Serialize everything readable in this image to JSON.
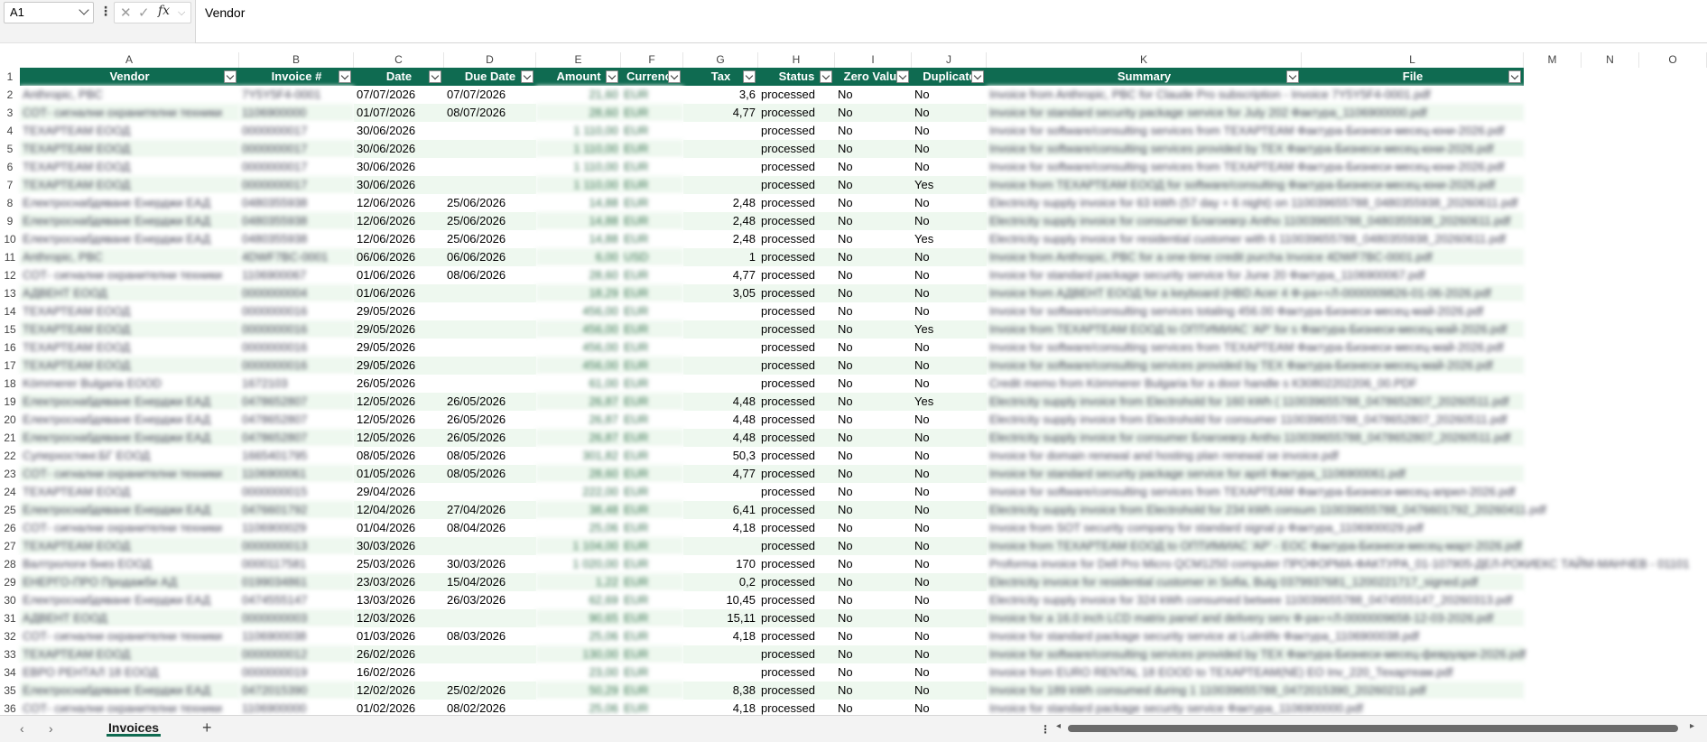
{
  "formula_bar": {
    "name_box": "A1",
    "fx": "fx",
    "content": "Vendor"
  },
  "columns": [
    "A",
    "B",
    "C",
    "D",
    "E",
    "F",
    "G",
    "H",
    "I",
    "J",
    "K",
    "L",
    "M",
    "N",
    "O"
  ],
  "header": [
    "Vendor",
    "Invoice #",
    "Date",
    "Due Date",
    "Amount",
    "Currency",
    "Tax",
    "Status",
    "Zero Value",
    "Duplicate",
    "Summary",
    "File"
  ],
  "rows": [
    {
      "n": "2",
      "vendor": "Anthropic, PBC",
      "inv": "7Y5Y5F4-0001",
      "date": "07/07/2026",
      "due": "07/07/2026",
      "amount": "21,60",
      "cur": "EUR",
      "tax": "3,6",
      "status": "processed",
      "zero": "No",
      "dup": "No",
      "summary": "Invoice from Anthropic, PBC for Claude Pro subscription - Invoice 7Y5Y5F4-0001.pdf"
    },
    {
      "n": "3",
      "vendor": "СОТ- сигнални охранителни техники",
      "inv": "1106900000",
      "date": "01/07/2026",
      "due": "08/07/2026",
      "amount": "28,60",
      "cur": "EUR",
      "tax": "4,77",
      "status": "processed",
      "zero": "No",
      "dup": "No",
      "summary": "Invoice for standard security package service for July 202 Фактура_1106900000.pdf"
    },
    {
      "n": "4",
      "vendor": "ТЕХАРТЕАМ ЕООД",
      "inv": "0000000017",
      "date": "30/06/2026",
      "due": "",
      "amount": "1 110,00",
      "cur": "EUR",
      "tax": "",
      "status": "processed",
      "zero": "No",
      "dup": "No",
      "summary": "Invoice for software/consulting services from ТЕХАРТЕАМ Фактура-Бизнеси-месец-юни-2026.pdf"
    },
    {
      "n": "5",
      "vendor": "ТЕХАРТЕАМ ЕООД",
      "inv": "0000000017",
      "date": "30/06/2026",
      "due": "",
      "amount": "1 110,00",
      "cur": "EUR",
      "tax": "",
      "status": "processed",
      "zero": "No",
      "dup": "No",
      "summary": "Invoice for software/consulting services provided by TEX Фактура-Бизнеси-месец-юни-2026.pdf"
    },
    {
      "n": "6",
      "vendor": "ТЕХАРТЕАМ ЕООД",
      "inv": "0000000017",
      "date": "30/06/2026",
      "due": "",
      "amount": "1 110,00",
      "cur": "EUR",
      "tax": "",
      "status": "processed",
      "zero": "No",
      "dup": "No",
      "summary": "Invoice for software/consulting services from ТЕХАРТЕАМ Фактура-Бизнеси-месец-юни-2026.pdf"
    },
    {
      "n": "7",
      "vendor": "ТЕХАРТЕАМ ЕООД",
      "inv": "0000000017",
      "date": "30/06/2026",
      "due": "",
      "amount": "1 110,00",
      "cur": "EUR",
      "tax": "",
      "status": "processed",
      "zero": "No",
      "dup": "Yes",
      "summary": "Invoice from ТЕХАРТЕАМ ЕООД for software/consulting Фактура-Бизнеси-месец-юни-2026.pdf"
    },
    {
      "n": "8",
      "vendor": "Електроснабдяване Енерджи ЕАД",
      "inv": "0480355938",
      "date": "12/06/2026",
      "due": "25/06/2026",
      "amount": "14,88",
      "cur": "EUR",
      "tax": "2,48",
      "status": "processed",
      "zero": "No",
      "dup": "No",
      "summary": "Electricity supply invoice for 63 kWh (57 day + 6 night) on 110039655788_0480355938_20260611.pdf"
    },
    {
      "n": "9",
      "vendor": "Електроснабдяване Енерджи ЕАД",
      "inv": "0480355938",
      "date": "12/06/2026",
      "due": "25/06/2026",
      "amount": "14,88",
      "cur": "EUR",
      "tax": "2,48",
      "status": "processed",
      "zero": "No",
      "dup": "No",
      "summary": "Electricity supply invoice for consumer Благоевгр Antho 110039655788_0480355938_20260611.pdf"
    },
    {
      "n": "10",
      "vendor": "Електроснабдяване Енерджи ЕАД",
      "inv": "0480355938",
      "date": "12/06/2026",
      "due": "25/06/2026",
      "amount": "14,88",
      "cur": "EUR",
      "tax": "2,48",
      "status": "processed",
      "zero": "No",
      "dup": "Yes",
      "summary": "Electricity supply invoice for residential customer with 6 110039655788_0480355938_20260611.pdf"
    },
    {
      "n": "11",
      "vendor": "Anthropic, PBC",
      "inv": "4DWF7BC-0001",
      "date": "06/06/2026",
      "due": "06/06/2026",
      "amount": "6,00",
      "cur": "USD",
      "tax": "1",
      "status": "processed",
      "zero": "No",
      "dup": "No",
      "summary": "Invoice from Anthropic, PBC for a one-time credit purcha Invoice 4DWF7BC-0001.pdf"
    },
    {
      "n": "12",
      "vendor": "СОТ- сигнални охранителни техники",
      "inv": "1106900067",
      "date": "01/06/2026",
      "due": "08/06/2026",
      "amount": "28,60",
      "cur": "EUR",
      "tax": "4,77",
      "status": "processed",
      "zero": "No",
      "dup": "No",
      "summary": "Invoice for standard package security service for June 20 Фактура_1106900067.pdf"
    },
    {
      "n": "13",
      "vendor": "АДВЕНТ ЕООД",
      "inv": "0000000004",
      "date": "01/06/2026",
      "due": "",
      "amount": "18,29",
      "cur": "EUR",
      "tax": "3,05",
      "status": "processed",
      "zero": "No",
      "dup": "No",
      "summary": "Invoice from АДВЕНТ ЕООД for a keyboard (HBD Acer 4 Ф-ра++Л-0000009826-01-06-2026.pdf"
    },
    {
      "n": "14",
      "vendor": "ТЕХАРТЕАМ ЕООД",
      "inv": "0000000016",
      "date": "29/05/2026",
      "due": "",
      "amount": "456,00",
      "cur": "EUR",
      "tax": "",
      "status": "processed",
      "zero": "No",
      "dup": "No",
      "summary": "Invoice for software/consulting services totaling 456.00 Фактура-Бизнеси-месец-май-2026.pdf"
    },
    {
      "n": "15",
      "vendor": "ТЕХАРТЕАМ ЕООД",
      "inv": "0000000016",
      "date": "29/05/2026",
      "due": "",
      "amount": "456,00",
      "cur": "EUR",
      "tax": "",
      "status": "processed",
      "zero": "No",
      "dup": "Yes",
      "summary": "Invoice from ТЕХАРТЕАМ ЕООД to ОПТИМИАС 'АР' for s Фактура-Бизнеси-месец-май-2026.pdf"
    },
    {
      "n": "16",
      "vendor": "ТЕХАРТЕАМ ЕООД",
      "inv": "0000000016",
      "date": "29/05/2026",
      "due": "",
      "amount": "456,00",
      "cur": "EUR",
      "tax": "",
      "status": "processed",
      "zero": "No",
      "dup": "No",
      "summary": "Invoice for software/consulting services from ТЕХАРТЕАМ Фактура-Бизнеси-месец-май-2026.pdf"
    },
    {
      "n": "17",
      "vendor": "ТЕХАРТЕАМ ЕООД",
      "inv": "0000000016",
      "date": "29/05/2026",
      "due": "",
      "amount": "456,00",
      "cur": "EUR",
      "tax": "",
      "status": "processed",
      "zero": "No",
      "dup": "No",
      "summary": "Invoice for software/consulting services provided by TEX Фактура-Бизнеси-месец-май-2026.pdf"
    },
    {
      "n": "18",
      "vendor": "Kömmerer Bulgaria EOOD",
      "inv": "1672103",
      "date": "26/05/2026",
      "due": "",
      "amount": "61,00",
      "cur": "EUR",
      "tax": "",
      "status": "processed",
      "zero": "No",
      "dup": "No",
      "summary": "Credit memo from Kömmerer Bulgaria for a door handle s КЗ0802202206_00.PDF"
    },
    {
      "n": "19",
      "vendor": "Електроснабдяване Енерджи ЕАД",
      "inv": "0478652807",
      "date": "12/05/2026",
      "due": "26/05/2026",
      "amount": "26,87",
      "cur": "EUR",
      "tax": "4,48",
      "status": "processed",
      "zero": "No",
      "dup": "Yes",
      "summary": "Electricity supply invoice from Electrohold for 160 kWh ( 110039655788_0478652807_20260511.pdf"
    },
    {
      "n": "20",
      "vendor": "Електроснабдяване Енерджи ЕАД",
      "inv": "0478652807",
      "date": "12/05/2026",
      "due": "26/05/2026",
      "amount": "26,87",
      "cur": "EUR",
      "tax": "4,48",
      "status": "processed",
      "zero": "No",
      "dup": "No",
      "summary": "Electricity supply invoice from Electrohold for consumer 110039655788_0478652807_20260511.pdf"
    },
    {
      "n": "21",
      "vendor": "Електроснабдяване Енерджи ЕАД",
      "inv": "0478652807",
      "date": "12/05/2026",
      "due": "26/05/2026",
      "amount": "26,87",
      "cur": "EUR",
      "tax": "4,48",
      "status": "processed",
      "zero": "No",
      "dup": "No",
      "summary": "Electricity supply invoice for consumer Благоевгр Antho 110039655788_0478652807_20260511.pdf"
    },
    {
      "n": "22",
      "vendor": "Суперхостинг.БГ ЕООД",
      "inv": "1665401795",
      "date": "08/05/2026",
      "due": "08/05/2026",
      "amount": "301,82",
      "cur": "EUR",
      "tax": "50,3",
      "status": "processed",
      "zero": "No",
      "dup": "No",
      "summary": "Invoice for domain renewal and hosting plan renewal se invoice.pdf"
    },
    {
      "n": "23",
      "vendor": "СОТ- сигнални охранителни техники",
      "inv": "1106900061",
      "date": "01/05/2026",
      "due": "08/05/2026",
      "amount": "28,60",
      "cur": "EUR",
      "tax": "4,77",
      "status": "processed",
      "zero": "No",
      "dup": "No",
      "summary": "Invoice for standard security package service for april Фактура_1106900061.pdf"
    },
    {
      "n": "24",
      "vendor": "ТЕХАРТЕАМ ЕООД",
      "inv": "0000000015",
      "date": "29/04/2026",
      "due": "",
      "amount": "222,00",
      "cur": "EUR",
      "tax": "",
      "status": "processed",
      "zero": "No",
      "dup": "No",
      "summary": "Invoice for software/consulting services from ТЕХАРТЕАМ Фактура-Бизнеси-месец-април-2026.pdf"
    },
    {
      "n": "25",
      "vendor": "Електроснабдяване Енерджи ЕАД",
      "inv": "0476601792",
      "date": "12/04/2026",
      "due": "27/04/2026",
      "amount": "38,48",
      "cur": "EUR",
      "tax": "6,41",
      "status": "processed",
      "zero": "No",
      "dup": "No",
      "summary": "Electricity supply invoice from Electrohold for 234 kWh consum 110039655788_0476601792_20260411.pdf"
    },
    {
      "n": "26",
      "vendor": "СОТ- сигнални охранителни техники",
      "inv": "1106900029",
      "date": "01/04/2026",
      "due": "08/04/2026",
      "amount": "25,06",
      "cur": "EUR",
      "tax": "4,18",
      "status": "processed",
      "zero": "No",
      "dup": "No",
      "summary": "Invoice from SOT security company for standard signal p Фактура_1106900029.pdf"
    },
    {
      "n": "27",
      "vendor": "ТЕХАРТЕАМ ЕООД",
      "inv": "0000000013",
      "date": "30/03/2026",
      "due": "",
      "amount": "1 104,00",
      "cur": "EUR",
      "tax": "",
      "status": "processed",
      "zero": "No",
      "dup": "No",
      "summary": "Invoice from ТЕХАРТЕАМ ЕООД to ОПТИМИАС 'АР' - ЕОС Фактура-Бизнеси-месец-март-2026.pdf"
    },
    {
      "n": "28",
      "vendor": "Валтрологи бнез ЕООД",
      "inv": "0000117581",
      "date": "25/03/2026",
      "due": "30/03/2026",
      "amount": "1 020,00",
      "cur": "EUR",
      "tax": "170",
      "status": "processed",
      "zero": "No",
      "dup": "No",
      "summary": "Proforma invoice for Dell Pro Micro QCM1250 computer ПРОФОРМА-ФАКТУРА_01-107905-ДЕЛ-РОКИЕКС ТАЙМ-МАНЧЕВ - 01101"
    },
    {
      "n": "29",
      "vendor": "ЕНЕРГО-ПРО Продажби АД",
      "inv": "0199034861",
      "date": "23/03/2026",
      "due": "15/04/2026",
      "amount": "1,22",
      "cur": "EUR",
      "tax": "0,2",
      "status": "processed",
      "zero": "No",
      "dup": "No",
      "summary": "Electricity invoice for residential customer in Sofia, Bulg 0379937681_1200221717_signed.pdf"
    },
    {
      "n": "30",
      "vendor": "Електроснабдяване Енерджи ЕАД",
      "inv": "0474555147",
      "date": "13/03/2026",
      "due": "26/03/2026",
      "amount": "62,69",
      "cur": "EUR",
      "tax": "10,45",
      "status": "processed",
      "zero": "No",
      "dup": "No",
      "summary": "Electricity supply invoice for 324 kWh consumed betwee 110039655788_0474555147_20260313.pdf"
    },
    {
      "n": "31",
      "vendor": "АДВЕНТ ЕООД",
      "inv": "0000000003",
      "date": "12/03/2026",
      "due": "",
      "amount": "90,65",
      "cur": "EUR",
      "tax": "15,11",
      "status": "processed",
      "zero": "No",
      "dup": "No",
      "summary": "Invoice for a 16.0 inch LCD matrix panel and delivery serv Ф-ра++Л-0000009658-12-03-2026.pdf"
    },
    {
      "n": "32",
      "vendor": "СОТ- сигнални охранителни техники",
      "inv": "1106900038",
      "date": "01/03/2026",
      "due": "08/03/2026",
      "amount": "25,06",
      "cur": "EUR",
      "tax": "4,18",
      "status": "processed",
      "zero": "No",
      "dup": "No",
      "summary": "Invoice for standard package security service at Lulinlife Фактура_1106900038.pdf"
    },
    {
      "n": "33",
      "vendor": "ТЕХАРТЕАМ ЕООД",
      "inv": "0000000012",
      "date": "26/02/2026",
      "due": "",
      "amount": "130,00",
      "cur": "EUR",
      "tax": "",
      "status": "processed",
      "zero": "No",
      "dup": "No",
      "summary": "Invoice for software/consulting services provided by TEX Фактура-Бизнеси-месец-февруари-2026.pdf"
    },
    {
      "n": "34",
      "vendor": "ЕВРО РЕНТАЛ 18 ЕООД",
      "inv": "0000000019",
      "date": "16/02/2026",
      "due": "",
      "amount": "23,00",
      "cur": "EUR",
      "tax": "",
      "status": "processed",
      "zero": "No",
      "dup": "No",
      "summary": "Invoice from EURO RENTAL 18 EOOD to ТЕХАРТЕАМ(NE) ЕО Inv_220_Техартеам.pdf"
    },
    {
      "n": "35",
      "vendor": "Електроснабдяване Енерджи ЕАД",
      "inv": "0472015390",
      "date": "12/02/2026",
      "due": "25/02/2026",
      "amount": "50,29",
      "cur": "EUR",
      "tax": "8,38",
      "status": "processed",
      "zero": "No",
      "dup": "No",
      "summary": "Invoice for 189 kWh consumed during 1 110039655788_0472015390_20260211.pdf"
    },
    {
      "n": "36",
      "vendor": "СОТ- сигнални охранителни техники",
      "inv": "1106900000",
      "date": "01/02/2026",
      "due": "08/02/2026",
      "amount": "25,06",
      "cur": "EUR",
      "tax": "4,18",
      "status": "processed",
      "zero": "No",
      "dup": "No",
      "summary": "Invoice for standard package security service Фактура_1106900000.pdf"
    }
  ],
  "tabbar": {
    "prev": "‹",
    "next": "›",
    "sheet_name": "Invoices",
    "add": "+"
  },
  "colors": {
    "header_bg": "#0f6b51",
    "band": "#eef8ef",
    "accent": "#0f6b51"
  }
}
